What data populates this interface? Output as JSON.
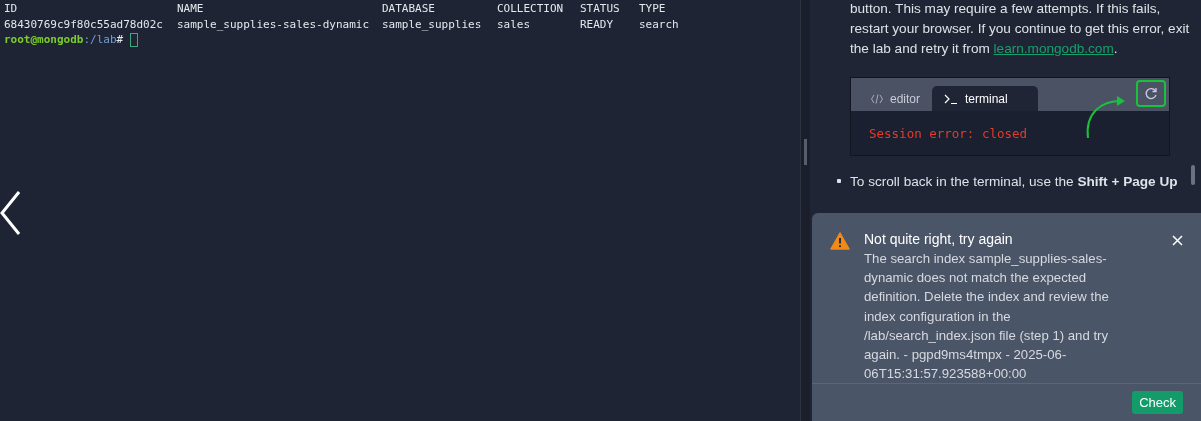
{
  "terminal": {
    "columns": [
      "ID",
      "NAME",
      "DATABASE",
      "COLLECTION",
      "STATUS",
      "TYPE"
    ],
    "rows": [
      [
        "68430769c9f80c55ad78d02c",
        "sample_supplies-sales-dynamic",
        "sample_supplies",
        "sales",
        "READY",
        "search"
      ]
    ],
    "prompt": {
      "user": "root@mongodb",
      "path": ":/lab",
      "symbol": "#"
    }
  },
  "instructions": {
    "paragraph": "button. This may require a few attempts. If this fails, restart your browser. If you continue to get this error, exit the lab and retry it from ",
    "link": "learn.mongodb.com",
    "after_link": ".",
    "figure": {
      "tabs": [
        {
          "label": "editor",
          "selected": false
        },
        {
          "label": "terminal",
          "selected": true
        }
      ],
      "error": "Session error: closed"
    },
    "bullets": [
      "To scroll back in the terminal, use the **Shift + Page Up**"
    ]
  },
  "toast": {
    "title": "Not quite right, try again",
    "message": "The search index sample_supplies-sales-dynamic does not match the expected definition. Delete the index and review the index configuration in the /lab/search_index.json file (step 1) and try again. - pgpd9ms4tmpx - 2025-06-06T15:31:57.923588+00:00",
    "button": "Check"
  }
}
